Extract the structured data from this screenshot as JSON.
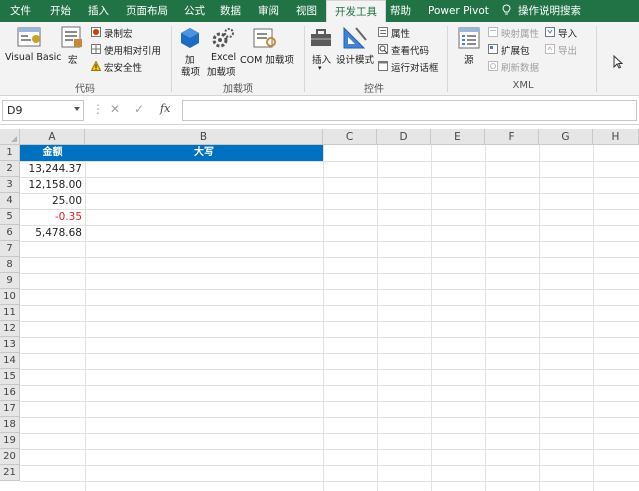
{
  "tabs": [
    "文件",
    "开始",
    "插入",
    "页面布局",
    "公式",
    "数据",
    "审阅",
    "视图",
    "开发工具",
    "帮助",
    "Power Pivot",
    "操作说明搜索"
  ],
  "active_tab": "开发工具",
  "ribbon": {
    "code": {
      "label": "代码",
      "visual_basic": "Visual Basic",
      "macros": "宏",
      "record_macro": "录制宏",
      "relative_ref": "使用相对引用",
      "macro_security": "宏安全性"
    },
    "addins": {
      "label": "加载项",
      "addins_line1": "加",
      "addins_line2": "载项",
      "excel_line1": "Excel",
      "excel_line2": "加载项",
      "com": "COM 加载项"
    },
    "controls": {
      "label": "控件",
      "insert": "插入",
      "design_mode": "设计模式",
      "properties": "属性",
      "view_code": "查看代码",
      "run_dialog": "运行对话框"
    },
    "xml": {
      "label": "XML",
      "source": "源",
      "map_props": "映射属性",
      "expansion_packs": "扩展包",
      "refresh_data": "刷新数据",
      "import": "导入",
      "export": "导出"
    }
  },
  "formula_bar": {
    "name_box": "D9",
    "fx": "fx",
    "formula": ""
  },
  "grid": {
    "columns": [
      "A",
      "B",
      "C",
      "D",
      "E",
      "F",
      "G",
      "H"
    ],
    "rows": [
      "1",
      "2",
      "3",
      "4",
      "5",
      "6",
      "7",
      "8",
      "9",
      "10",
      "11",
      "12",
      "13",
      "14",
      "15",
      "16",
      "17",
      "18",
      "19",
      "20",
      "21"
    ],
    "header_a": "金额",
    "header_b": "大写",
    "values": [
      "13,244.37",
      "12,158.00",
      "25.00",
      "-0.35",
      "5,478.68"
    ]
  },
  "colors": {
    "ribbon_green": "#217346",
    "header_fill": "#0070c0",
    "negative": "#e02020"
  }
}
